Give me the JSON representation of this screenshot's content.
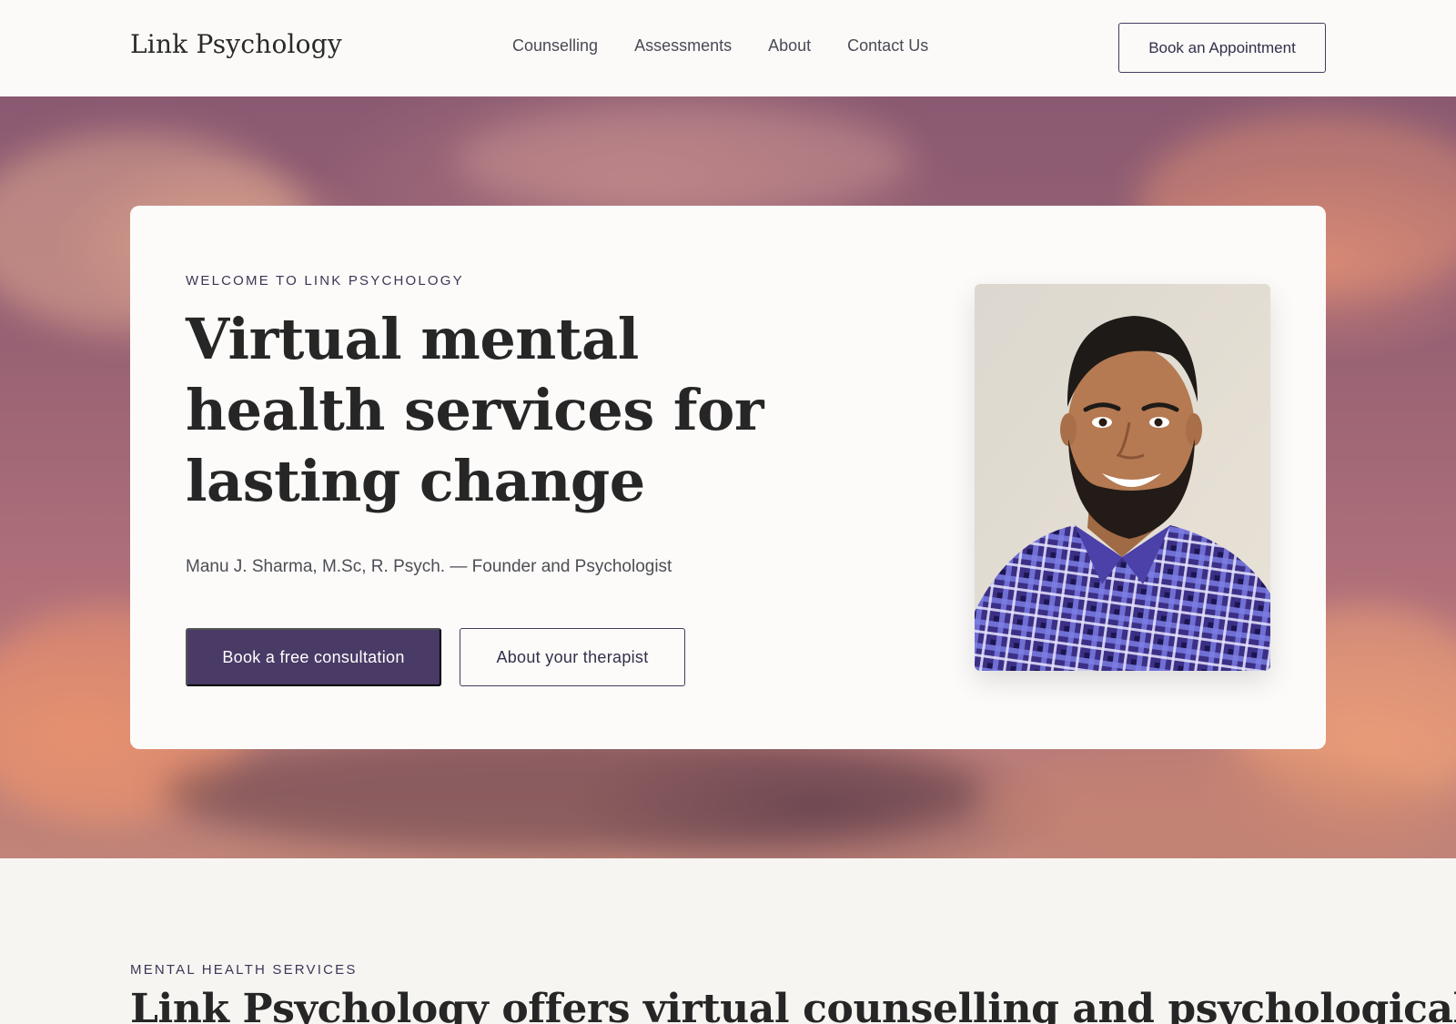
{
  "header": {
    "logo": "Link Psychology",
    "nav": [
      "Counselling",
      "Assessments",
      "About",
      "Contact Us"
    ],
    "cta_label": "Book an Appointment"
  },
  "hero": {
    "eyebrow": "WELCOME TO LINK PSYCHOLOGY",
    "title": "Virtual mental health services for lasting change",
    "subtitle": "Manu J. Sharma, M.Sc, R. Psych. — Founder and Psychologist",
    "primary_button": "Book a free consultation",
    "secondary_button": "About your therapist",
    "photo_icon": "therapist-portrait"
  },
  "services": {
    "eyebrow": "MENTAL HEALTH SERVICES",
    "title": "Link Psychology offers virtual counselling and psychological"
  },
  "colors": {
    "accent": "#4a3a66",
    "background": "#f7f5f2",
    "card": "#fcfbf9",
    "text": "#262626"
  }
}
